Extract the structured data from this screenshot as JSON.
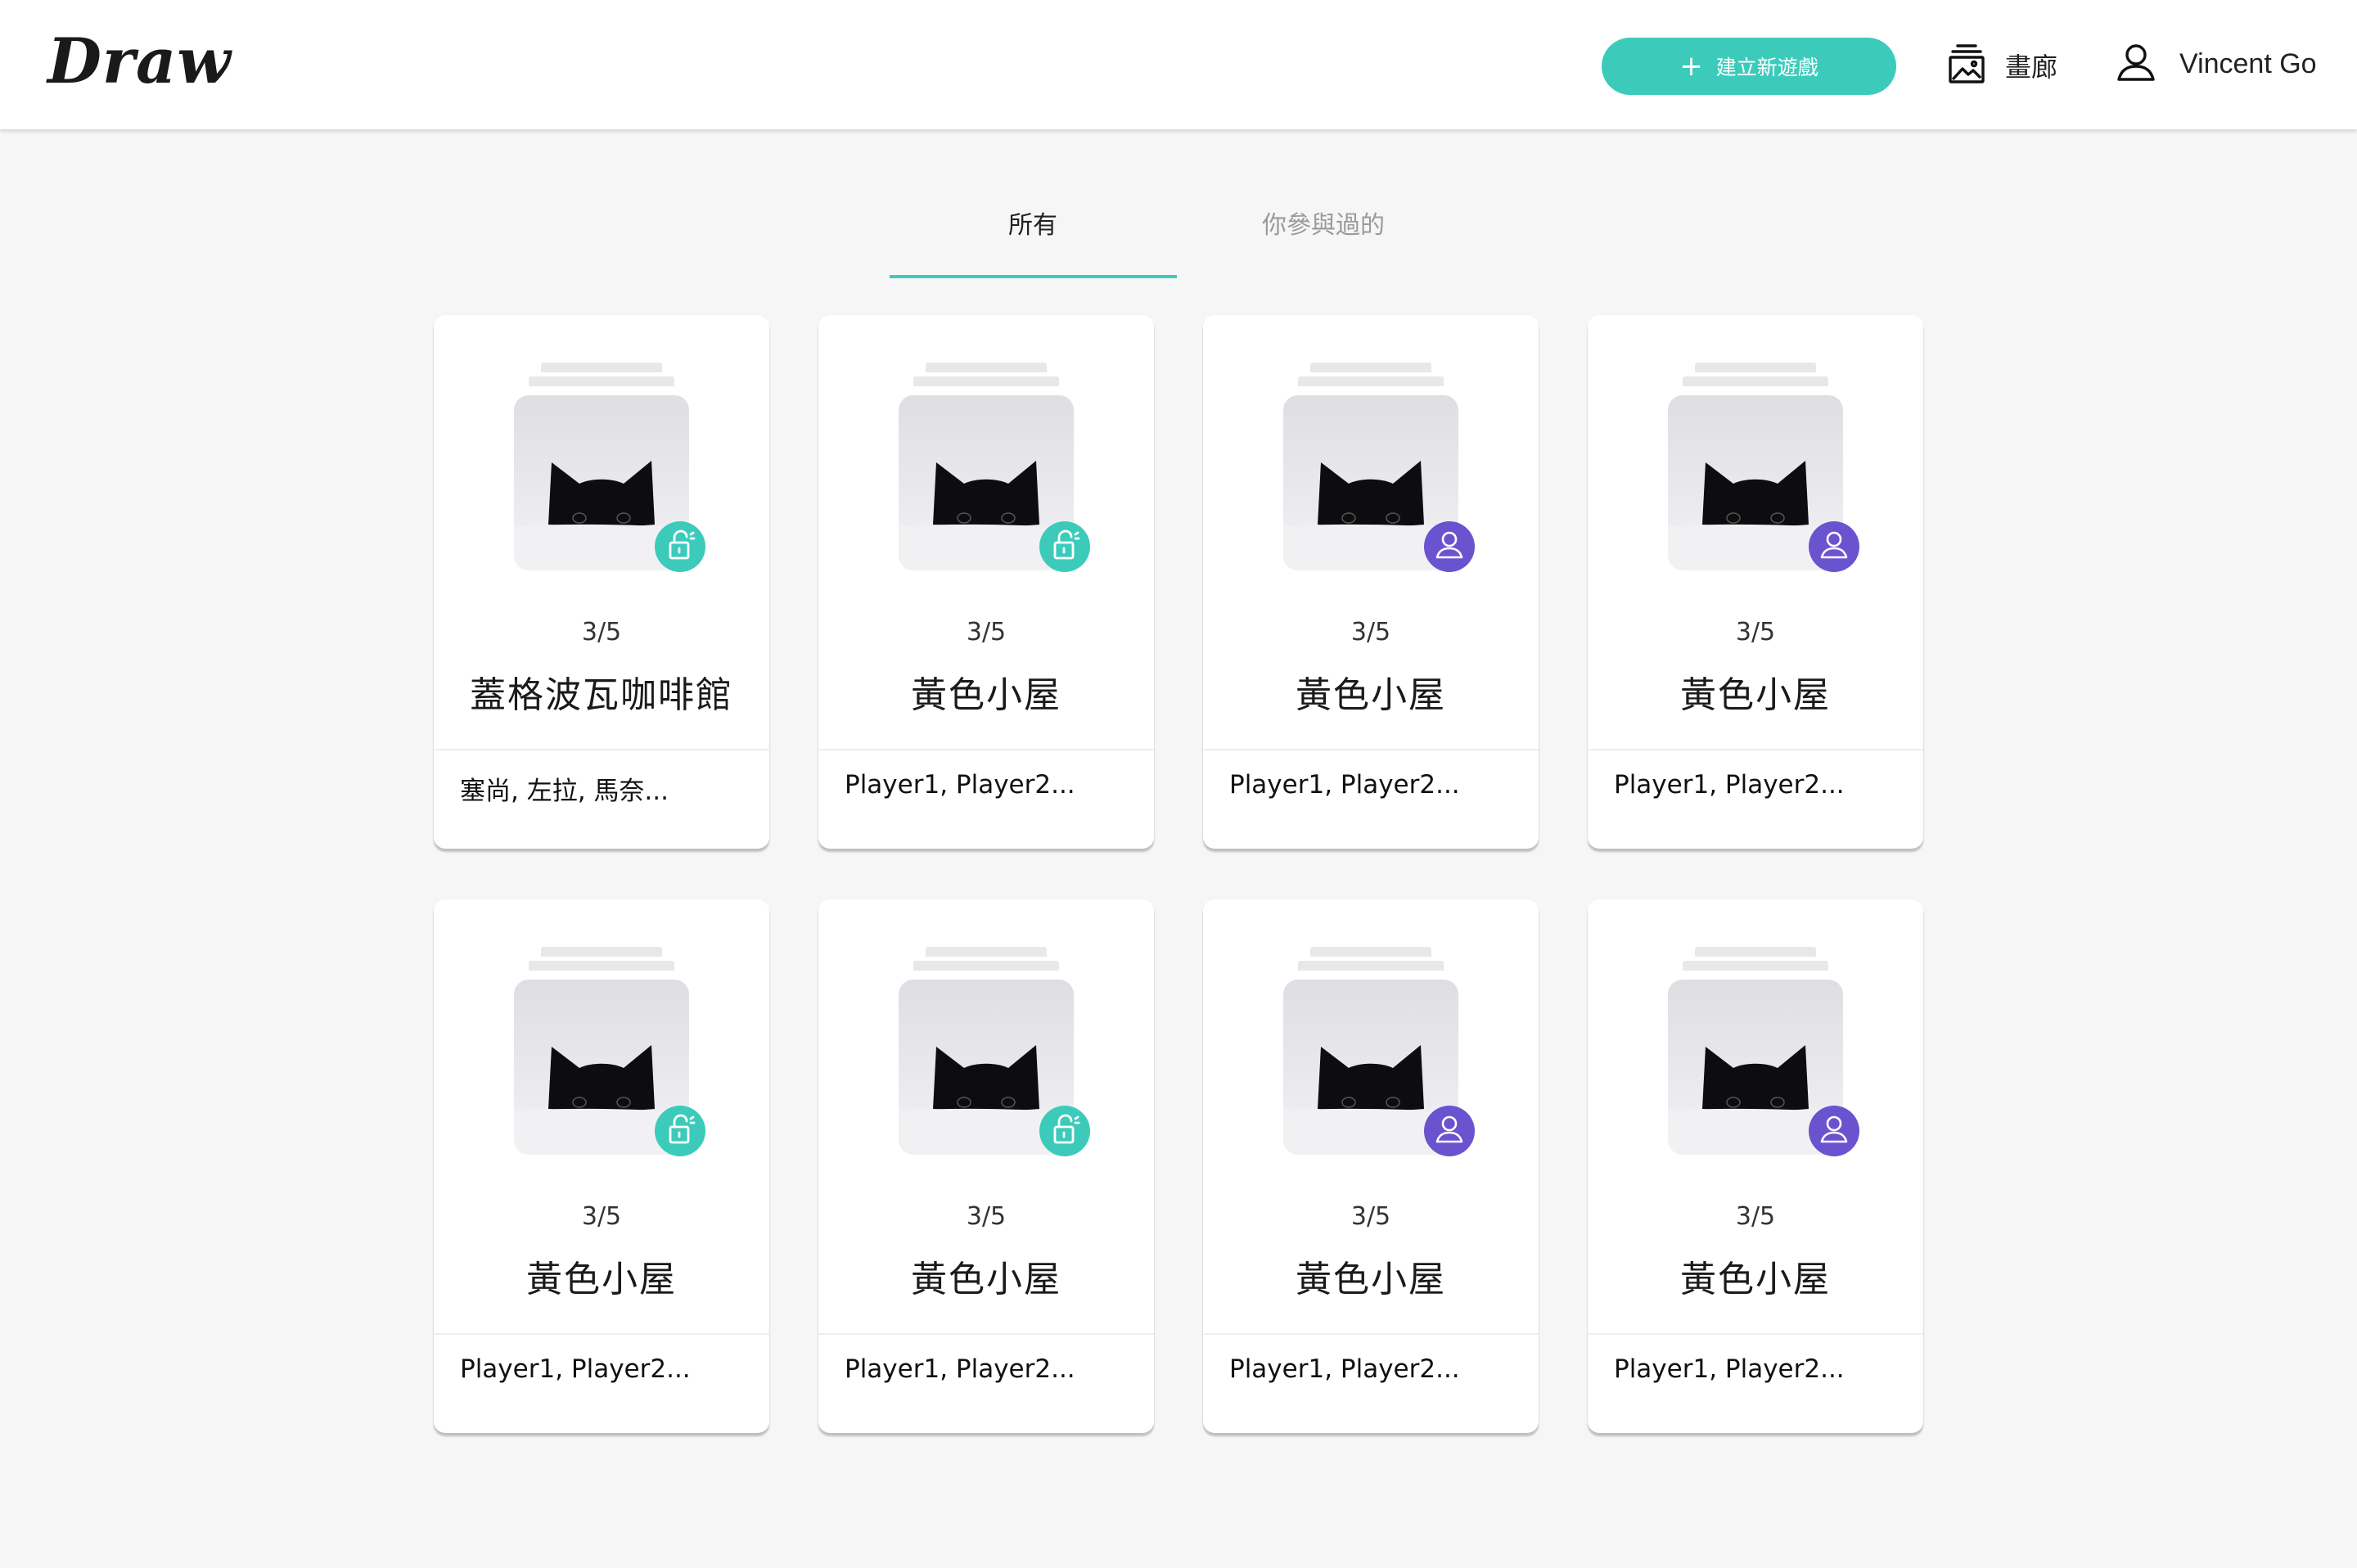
{
  "header": {
    "logo": "Draw",
    "new_game_label": "建立新遊戲",
    "gallery_label": "畫廊",
    "user_name": "Vincent Go"
  },
  "tabs": [
    {
      "label": "所有",
      "active": true
    },
    {
      "label": "你參與過的",
      "active": false
    }
  ],
  "colors": {
    "accent": "#3ccbbb",
    "user_badge": "#6a53cf"
  },
  "games": [
    {
      "count": "3/5",
      "title": "蓋格波瓦咖啡館",
      "players": "塞尚, 左拉, 馬奈...",
      "status_icon": "unlock-icon"
    },
    {
      "count": "3/5",
      "title": "黃色小屋",
      "players": "Player1, Player2...",
      "status_icon": "unlock-icon"
    },
    {
      "count": "3/5",
      "title": "黃色小屋",
      "players": "Player1, Player2...",
      "status_icon": "user-icon"
    },
    {
      "count": "3/5",
      "title": "黃色小屋",
      "players": "Player1, Player2...",
      "status_icon": "user-icon"
    },
    {
      "count": "3/5",
      "title": "黃色小屋",
      "players": "Player1, Player2...",
      "status_icon": "unlock-icon"
    },
    {
      "count": "3/5",
      "title": "黃色小屋",
      "players": "Player1, Player2...",
      "status_icon": "unlock-icon"
    },
    {
      "count": "3/5",
      "title": "黃色小屋",
      "players": "Player1, Player2...",
      "status_icon": "user-icon"
    },
    {
      "count": "3/5",
      "title": "黃色小屋",
      "players": "Player1, Player2...",
      "status_icon": "user-icon"
    }
  ]
}
